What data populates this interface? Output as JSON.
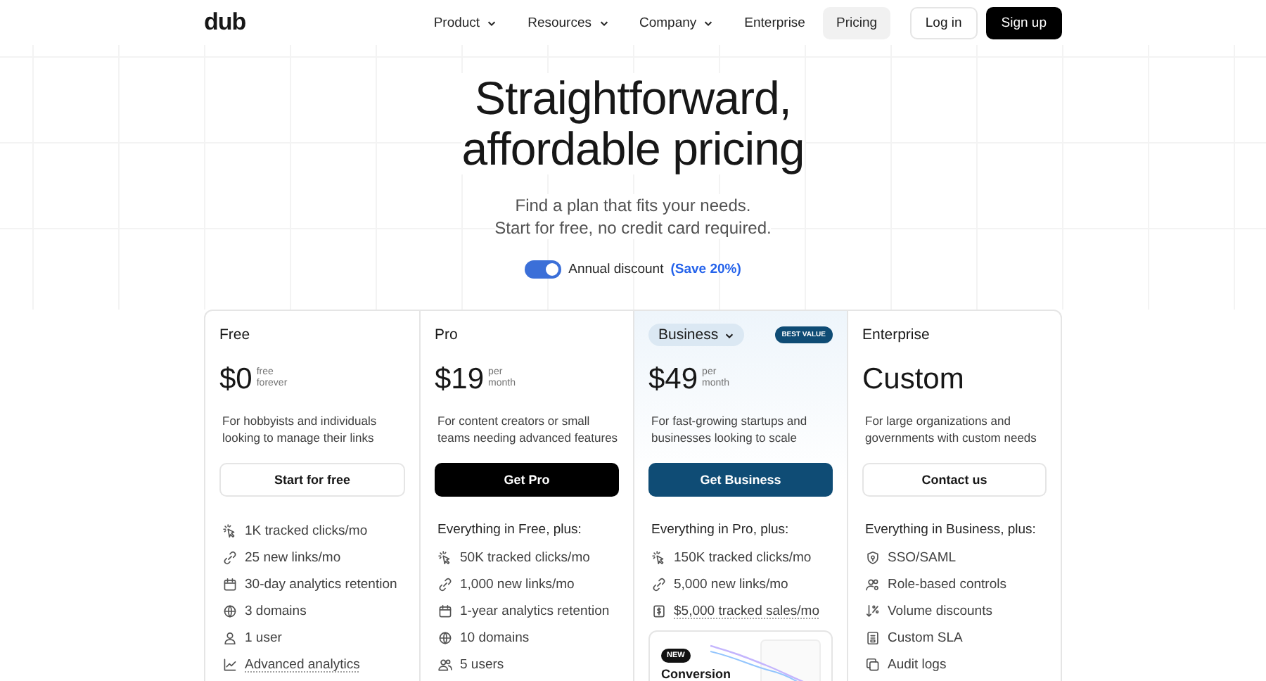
{
  "header": {
    "logo": "dub",
    "nav": [
      {
        "label": "Product",
        "dropdown": true,
        "selected": false
      },
      {
        "label": "Resources",
        "dropdown": true,
        "selected": false
      },
      {
        "label": "Company",
        "dropdown": true,
        "selected": false
      },
      {
        "label": "Enterprise",
        "dropdown": false,
        "selected": false
      },
      {
        "label": "Pricing",
        "dropdown": false,
        "selected": true
      }
    ],
    "login": "Log in",
    "signup": "Sign up"
  },
  "hero": {
    "title_lines": [
      "Straightforward,",
      "affordable pricing"
    ],
    "subtitle_lines": [
      "Find a plan that fits your needs.",
      "Start for free, no credit card required."
    ]
  },
  "toggle": {
    "on": true,
    "label": "Annual discount",
    "highlight": "(Save 20%)"
  },
  "plans": [
    {
      "name": "Free",
      "pill": false,
      "highlighted": false,
      "price": "$0",
      "price_note": [
        "free",
        "forever"
      ],
      "description": "For hobbyists and individuals looking to manage their links",
      "button": {
        "label": "Start for free",
        "kind": "outline"
      },
      "features": [
        {
          "kind": "clicks",
          "text": "1K tracked clicks/mo",
          "underlined": false
        },
        {
          "kind": "links",
          "text": "25 new links/mo",
          "underlined": false
        },
        {
          "kind": "calendar",
          "text": "30-day analytics retention",
          "underlined": false
        },
        {
          "kind": "globe",
          "text": "3 domains",
          "underlined": false
        },
        {
          "kind": "user",
          "text": "1 user",
          "underlined": false
        },
        {
          "kind": "chart",
          "text": "Advanced analytics",
          "underlined": true
        }
      ]
    },
    {
      "name": "Pro",
      "pill": false,
      "highlighted": false,
      "price": "$19",
      "price_note": [
        "per",
        "month"
      ],
      "description": "For content creators or small teams needing advanced features",
      "button": {
        "label": "Get Pro",
        "kind": "dark"
      },
      "features_heading": "Everything in Free, plus:",
      "features": [
        {
          "kind": "clicks",
          "text": "50K tracked clicks/mo",
          "underlined": false
        },
        {
          "kind": "links",
          "text": "1,000 new links/mo",
          "underlined": false
        },
        {
          "kind": "calendar",
          "text": "1-year analytics retention",
          "underlined": false
        },
        {
          "kind": "globe",
          "text": "10 domains",
          "underlined": false
        },
        {
          "kind": "users",
          "text": "5 users",
          "underlined": false
        }
      ]
    },
    {
      "name": "Business",
      "pill": true,
      "badge": "BEST VALUE",
      "highlighted": true,
      "price": "$49",
      "price_note": [
        "per",
        "month"
      ],
      "description": "For fast-growing startups and businesses looking to scale",
      "button": {
        "label": "Get Business",
        "kind": "blue"
      },
      "features_heading": "Everything in Pro, plus:",
      "features": [
        {
          "kind": "clicks",
          "text": "150K tracked clicks/mo",
          "underlined": false
        },
        {
          "kind": "links",
          "text": "5,000 new links/mo",
          "underlined": false
        },
        {
          "kind": "dollar",
          "text": "$5,000 tracked sales/mo",
          "underlined": true
        }
      ],
      "promo": {
        "badge": "NEW",
        "title": "Conversion"
      }
    },
    {
      "name": "Enterprise",
      "pill": false,
      "highlighted": false,
      "price": "Custom",
      "description": "For large organizations and governments with custom needs",
      "button": {
        "label": "Contact us",
        "kind": "outline"
      },
      "features_heading": "Everything in Business, plus:",
      "features": [
        {
          "kind": "shield",
          "text": "SSO/SAML",
          "underlined": false
        },
        {
          "kind": "role",
          "text": "Role-based controls",
          "underlined": false
        },
        {
          "kind": "discount",
          "text": "Volume discounts",
          "underlined": false
        },
        {
          "kind": "sla",
          "text": "Custom SLA",
          "underlined": false
        },
        {
          "kind": "logs",
          "text": "Audit logs",
          "underlined": false
        }
      ]
    }
  ]
}
